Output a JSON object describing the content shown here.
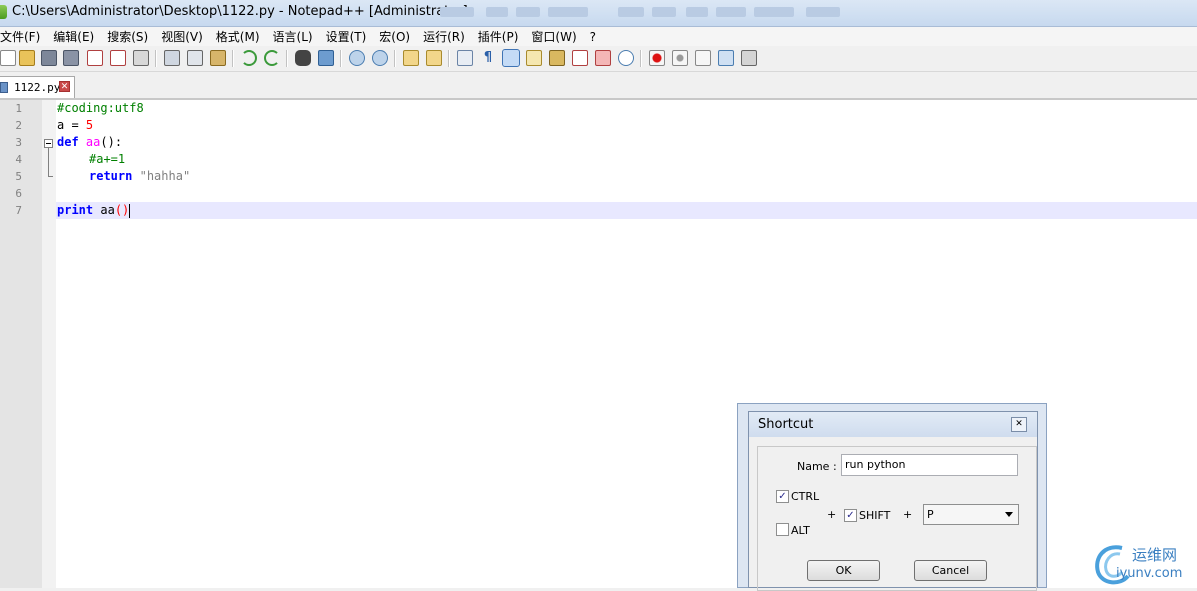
{
  "window": {
    "title": "C:\\Users\\Administrator\\Desktop\\1122.py - Notepad++ [Administrator]"
  },
  "menu": {
    "items": [
      "文件(F)",
      "编辑(E)",
      "搜索(S)",
      "视图(V)",
      "格式(M)",
      "语言(L)",
      "设置(T)",
      "宏(O)",
      "运行(R)",
      "插件(P)",
      "窗口(W)",
      "?"
    ]
  },
  "toolbar": {
    "icons": [
      "new-file-icon",
      "open-file-icon",
      "save-icon",
      "save-all-icon",
      "close-icon",
      "close-all-icon",
      "print-icon",
      "cut-icon",
      "copy-icon",
      "paste-icon",
      "undo-icon",
      "redo-icon",
      "find-icon",
      "replace-icon",
      "zoom-in-icon",
      "zoom-out-icon",
      "sync-vertical-icon",
      "sync-horizontal-icon",
      "word-wrap-icon",
      "show-all-chars-icon",
      "indent-guide-icon",
      "user-language-icon",
      "doc-map-icon",
      "function-list-icon",
      "folder-workspace-icon",
      "monitoring-icon",
      "record-macro-icon",
      "stop-macro-icon",
      "play-macro-icon",
      "run-multiple-macro-icon",
      "save-macro-icon"
    ]
  },
  "tab": {
    "label": "1122.py",
    "close": "✕"
  },
  "editor": {
    "line_numbers": [
      "1",
      "2",
      "3",
      "4",
      "5",
      "6",
      "7"
    ],
    "lines": {
      "l1": "#coding:utf8",
      "l2_var": "a",
      "l2_op": " = ",
      "l2_num": "5",
      "l3_kw": "def",
      "l3_name": "aa",
      "l3_rest": "():",
      "l4_comment": "#a+=1",
      "l5_kw": "return",
      "l5_str": "\"hahha\"",
      "l7_kw": "print",
      "l7_name": "aa",
      "l7_paren": "()"
    },
    "current_line": 7
  },
  "dialog": {
    "title": "Shortcut",
    "close": "✕",
    "name_label": "Name :",
    "name_value": "run python",
    "ctrl_label": "CTRL",
    "ctrl_checked": true,
    "alt_label": "ALT",
    "alt_checked": false,
    "shift_label": "SHIFT",
    "shift_checked": true,
    "plus1": "+",
    "plus2": "+",
    "key_value": "P",
    "ok_label": "OK",
    "cancel_label": "Cancel"
  },
  "watermark": {
    "cn": "运维网",
    "en": "iyunv.com"
  },
  "colors": {
    "keyword": "#0000ff",
    "comment": "#008000",
    "number": "#ff0000",
    "string": "#808080",
    "current_line_bg": "#e8e8ff"
  }
}
